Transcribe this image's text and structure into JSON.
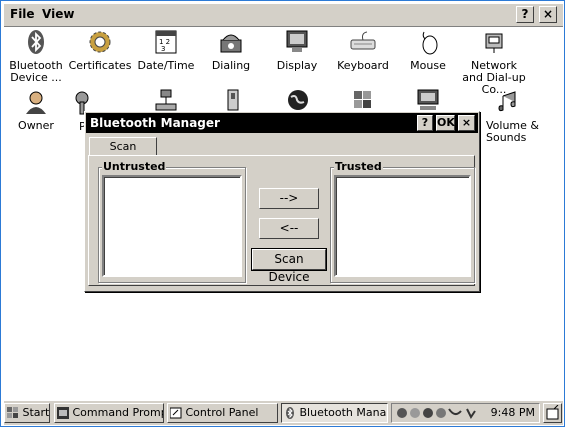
{
  "menubar": {
    "file_label": "File",
    "view_label": "View",
    "help_label": "?",
    "close_label": "×"
  },
  "icons_row1": [
    {
      "label": "Bluetooth Device ...",
      "icon": "bluetooth-icon"
    },
    {
      "label": "Certificates",
      "icon": "certificates-icon"
    },
    {
      "label": "Date/Time",
      "icon": "date-time-icon"
    },
    {
      "label": "Dialing",
      "icon": "dialing-icon"
    },
    {
      "label": "Display",
      "icon": "display-icon"
    },
    {
      "label": "Keyboard",
      "icon": "keyboard-icon"
    },
    {
      "label": "Mouse",
      "icon": "mouse-icon"
    },
    {
      "label": "Network and Dial-up Co...",
      "icon": "network-icon"
    }
  ],
  "icons_row2": [
    {
      "label": "Owner",
      "icon": "owner-icon"
    },
    {
      "label": "P",
      "icon": "password-icon"
    },
    {
      "label": "Volume & Sounds",
      "icon": "volume-icon"
    }
  ],
  "dialog": {
    "title": "Bluetooth Manager",
    "help_label": "?",
    "ok_label": "OK",
    "close_label": "×",
    "tab_label": "Scan Device",
    "untrusted_label": "Untrusted",
    "trusted_label": "Trusted",
    "move_right_label": "-->",
    "move_left_label": "<--",
    "scan_label": "Scan Device"
  },
  "taskbar": {
    "start_label": "Start",
    "command_prompt_label": "Command Prompt",
    "control_panel_label": "Control Panel",
    "bluetooth_label": "Bluetooth Mana...",
    "clock": "9:48 PM"
  }
}
